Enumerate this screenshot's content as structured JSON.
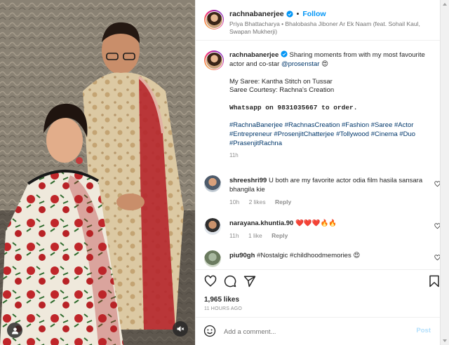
{
  "post": {
    "username": "rachnabanerjee",
    "follow_label": "Follow",
    "separator": "•",
    "audio": "Priya Bhattacharya • Bhalobasha Jiboner Ar Ek Naam (feat. Sohail Kaul, Swapan Mukherji)"
  },
  "caption": {
    "username": "rachnabanerjee",
    "text": "Sharing moments from with my most favourite actor and co-star",
    "mention": "@prosenstar",
    "emoji": "😍",
    "line1": "My Saree: Kantha Stitch on Tussar",
    "line2": "Saree Courtesy: Rachna's Creation",
    "whatsapp": "Whatsapp on 9831035667 to order.",
    "hashtags": "#RachnaBanerjee #RachnasCreation #Fashion #Saree #Actor #Entrepreneur #ProsenjitChatterjee #Tollywood #Cinema #Duo #PrasenjitRachna",
    "time": "11h"
  },
  "comments": [
    {
      "username": "shreeshri99",
      "text": "U both are my favorite actor odia film hasila sansara bhangila kie",
      "time": "10h",
      "likes": "2 likes",
      "reply": "Reply"
    },
    {
      "username": "narayana.khuntia.90",
      "text": "❤️❤️❤️🔥🔥",
      "time": "11h",
      "likes": "1 like",
      "reply": "Reply"
    },
    {
      "username": "piu90gh",
      "text": "#Nostalgic #childhoodmemories 😍",
      "time": "",
      "likes": "",
      "reply": ""
    }
  ],
  "stats": {
    "likes": "1,965 likes",
    "time": "11 HOURS AGO"
  },
  "composer": {
    "placeholder": "Add a comment...",
    "post_label": "Post"
  },
  "colors": {
    "accent": "#0095f6",
    "link": "#00376b",
    "muted": "#8e8e8e",
    "heart": "#ed4956"
  },
  "icons": [
    "user-icon",
    "mute-icon",
    "verified-icon",
    "heart-icon",
    "comment-icon",
    "share-icon",
    "bookmark-icon",
    "emoji-icon"
  ]
}
